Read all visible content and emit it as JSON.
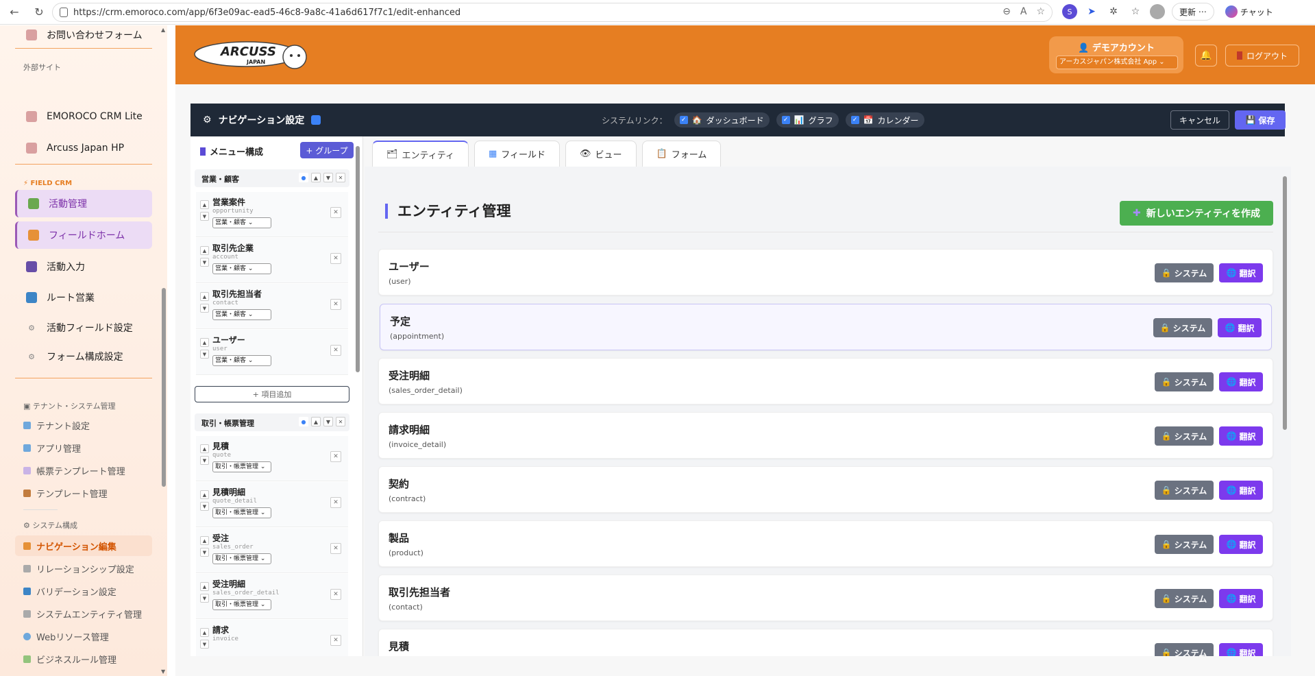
{
  "browser": {
    "url": "https://crm.emoroco.com/app/6f3e09ac-ead5-46c8-9a8c-41a6d617f7c1/edit-enhanced",
    "update_label": "更新",
    "chat_label": "チャット"
  },
  "sidebar": {
    "top_item": "お問い合わせフォーム",
    "external_heading": "外部サイト",
    "external": [
      "EMOROCO CRM Lite",
      "Arcuss Japan HP"
    ],
    "field_crm_heading": "FIELD CRM",
    "field_items": [
      "活動管理",
      "フィールドホーム",
      "活動入力",
      "ルート営業",
      "活動フィールド設定",
      "フォーム構成設定"
    ],
    "tenant_heading": "テナント・システム管理",
    "tenant_items": [
      "テナント設定",
      "アプリ管理",
      "帳票テンプレート管理",
      "テンプレート管理"
    ],
    "system_heading": "システム構成",
    "system_items": [
      "ナビゲーション編集",
      "リレーションシップ設定",
      "バリデーション設定",
      "システムエンティティ管理",
      "Webリソース管理",
      "ビジネスルール管理"
    ]
  },
  "header": {
    "logo_text": "ARCUSS",
    "logo_sub": "JAPAN",
    "account_name": "デモアカウント",
    "account_select": "アーカスジャパン株式会社 App",
    "logout_label": "ログアウト"
  },
  "nav_settings": {
    "title": "ナビゲーション設定",
    "system_links_label": "システムリンク：",
    "links": [
      "ダッシュボード",
      "グラフ",
      "カレンダー"
    ],
    "cancel_label": "キャンセル",
    "save_label": "保存"
  },
  "menu": {
    "title": "メニュー構成",
    "group_button": "+ グループ",
    "add_item_label": "+ 項目追加",
    "groups": [
      {
        "name": "営業・顧客",
        "items": [
          {
            "name": "営業案件",
            "code": "opportunity",
            "group": "営業・顧客"
          },
          {
            "name": "取引先企業",
            "code": "account",
            "group": "営業・顧客"
          },
          {
            "name": "取引先担当者",
            "code": "contact",
            "group": "営業・顧客"
          },
          {
            "name": "ユーザー",
            "code": "user",
            "group": "営業・顧客"
          }
        ]
      },
      {
        "name": "取引・帳票管理",
        "items": [
          {
            "name": "見積",
            "code": "quote",
            "group": "取引・帳票管理"
          },
          {
            "name": "見積明細",
            "code": "quote_detail",
            "group": "取引・帳票管理"
          },
          {
            "name": "受注",
            "code": "sales_order",
            "group": "取引・帳票管理"
          },
          {
            "name": "受注明細",
            "code": "sales_order_detail",
            "group": "取引・帳票管理"
          },
          {
            "name": "請求",
            "code": "invoice",
            "group": ""
          }
        ]
      }
    ]
  },
  "tabs": [
    "エンティティ",
    "フィールド",
    "ビュー",
    "フォーム"
  ],
  "entity_mgmt": {
    "title": "エンティティ管理",
    "create_label": "新しいエンティティを作成",
    "system_label": "システム",
    "translate_label": "翻訳",
    "entities": [
      {
        "name": "ユーザー",
        "code": "(user)"
      },
      {
        "name": "予定",
        "code": "(appointment)"
      },
      {
        "name": "受注明細",
        "code": "(sales_order_detail)"
      },
      {
        "name": "請求明細",
        "code": "(invoice_detail)"
      },
      {
        "name": "契約",
        "code": "(contract)"
      },
      {
        "name": "製品",
        "code": "(product)"
      },
      {
        "name": "取引先担当者",
        "code": "(contact)"
      },
      {
        "name": "見積",
        "code": ""
      }
    ]
  },
  "colors": {
    "brand_orange": "#e67e22",
    "nav_dark": "#1f2937",
    "accent_purple": "#7c3aed",
    "create_green": "#4caf50"
  }
}
